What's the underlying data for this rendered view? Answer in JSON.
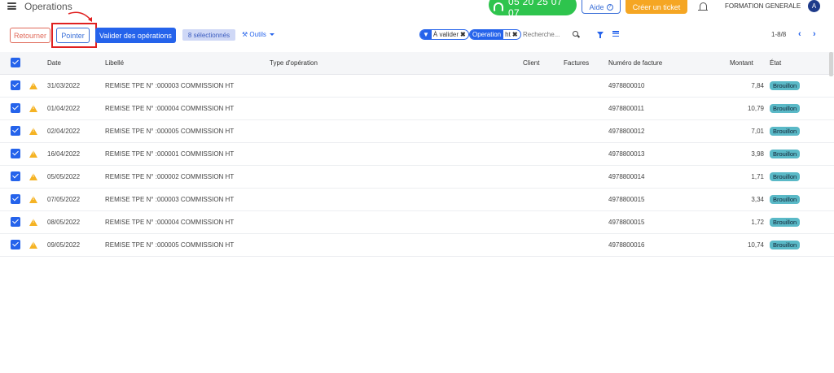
{
  "header": {
    "title": "Operations",
    "phone": "05 20 25 07 07",
    "help_label": "Aide",
    "ticket_label": "Créer un ticket",
    "company": "FORMATION GENERALE",
    "avatar_initial": "A"
  },
  "toolbar": {
    "return_label": "Retourner",
    "pointer_label": "Pointer",
    "validate_label": "Valider des opérations",
    "selected_label": "8 sélectionnés",
    "tools_label": "Outils"
  },
  "filters": {
    "chip1_key": "À valider",
    "chip2_key": "Operation",
    "chip2_value": "ht",
    "search_placeholder": "Recherche...",
    "pager": "1-8/8"
  },
  "table": {
    "headers": {
      "date": "Date",
      "label": "Libellé",
      "type": "Type d'opération",
      "client": "Client",
      "invoices": "Factures",
      "invoice_number": "Numéro de facture",
      "amount": "Montant",
      "state": "État"
    },
    "rows": [
      {
        "date": "31/03/2022",
        "label": "REMISE TPE N° :000003 COMMISSION HT",
        "invoice": "4978800010",
        "amount": "7,84",
        "state": "Brouillon"
      },
      {
        "date": "01/04/2022",
        "label": "REMISE TPE N° :000004 COMMISSION HT",
        "invoice": "4978800011",
        "amount": "10,79",
        "state": "Brouillon"
      },
      {
        "date": "02/04/2022",
        "label": "REMISE TPE N° :000005 COMMISSION HT",
        "invoice": "4978800012",
        "amount": "7,01",
        "state": "Brouillon"
      },
      {
        "date": "16/04/2022",
        "label": "REMISE TPE N° :000001 COMMISSION HT",
        "invoice": "4978800013",
        "amount": "3,98",
        "state": "Brouillon"
      },
      {
        "date": "05/05/2022",
        "label": "REMISE TPE N° :000002 COMMISSION HT",
        "invoice": "4978800014",
        "amount": "1,71",
        "state": "Brouillon"
      },
      {
        "date": "07/05/2022",
        "label": "REMISE TPE N° :000003 COMMISSION HT",
        "invoice": "4978800015",
        "amount": "3,34",
        "state": "Brouillon"
      },
      {
        "date": "08/05/2022",
        "label": "REMISE TPE N° :000004 COMMISSION HT",
        "invoice": "4978800015",
        "amount": "1,72",
        "state": "Brouillon"
      },
      {
        "date": "09/05/2022",
        "label": "REMISE TPE N° :000005 COMMISSION HT",
        "invoice": "4978800016",
        "amount": "10,74",
        "state": "Brouillon"
      }
    ]
  },
  "colors": {
    "primary": "#2563eb",
    "phone_green": "#2ec44d",
    "ticket_orange": "#f5a623",
    "status_teal": "#5ab9c7",
    "highlight_red": "#e02020"
  }
}
